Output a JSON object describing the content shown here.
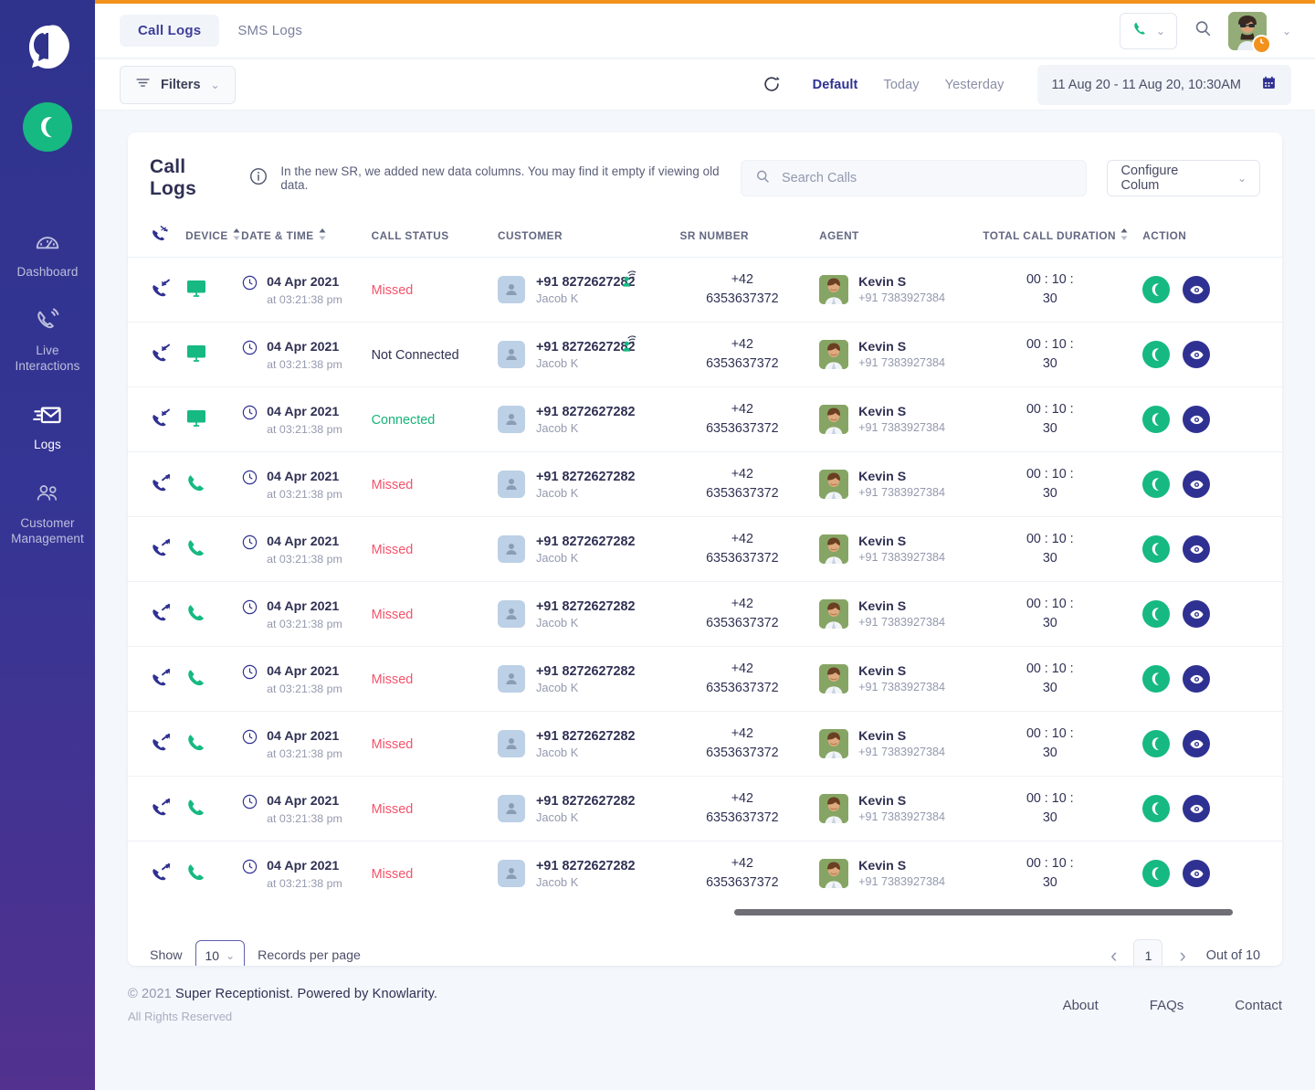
{
  "brand": {
    "accent_orange": "#f2921d",
    "green": "#16b981",
    "navy": "#2f3192",
    "red": "#f4526b"
  },
  "sidebar": {
    "logo_name": "headset-logo",
    "call_button_label": "",
    "items": [
      {
        "label": "Dashboard",
        "icon": "gauge-icon",
        "active": false
      },
      {
        "label": "Live\nInteractions",
        "icon": "live-call-icon",
        "active": false
      },
      {
        "label": "Logs",
        "icon": "envelope-icon",
        "active": true
      },
      {
        "label": "Customer\nManagement",
        "icon": "people-icon",
        "active": false
      }
    ]
  },
  "header": {
    "tabs": [
      {
        "label": "Call Logs",
        "active": true
      },
      {
        "label": "SMS Logs",
        "active": false
      }
    ],
    "call_icon": "phone-icon",
    "search_icon": "search-icon",
    "avatar_icon": "user-avatar",
    "status_badge_icon": "clock-icon"
  },
  "filterbar": {
    "filters_label": "Filters",
    "filters_icon": "filter-icon",
    "refresh_icon": "refresh-icon",
    "ranges": [
      {
        "label": "Default",
        "active": true
      },
      {
        "label": "Today",
        "active": false
      },
      {
        "label": "Yesterday",
        "active": false
      }
    ],
    "date_range": "11 Aug 20 - 11 Aug 20, 10:30AM",
    "calendar_icon": "calendar-icon"
  },
  "card": {
    "title": "Call Logs",
    "info_icon": "info-icon",
    "note": "In the new SR, we added new data columns. You may find it empty if viewing old data.",
    "search_placeholder": "Search Calls",
    "search_value": "",
    "configure_label": "Configure Colum"
  },
  "table": {
    "columns": [
      {
        "key": "direction",
        "label": "",
        "icon": "call-direction-icon",
        "sortable": false
      },
      {
        "key": "device",
        "label": "DEVICE",
        "sortable": true
      },
      {
        "key": "datetime",
        "label": "DATE & TIME",
        "sortable": true
      },
      {
        "key": "status",
        "label": "CALL STATUS",
        "sortable": false
      },
      {
        "key": "customer",
        "label": "CUSTOMER",
        "sortable": false
      },
      {
        "key": "sr_number",
        "label": "SR NUMBER",
        "sortable": false
      },
      {
        "key": "agent",
        "label": "AGENT",
        "sortable": false
      },
      {
        "key": "duration",
        "label": "TOTAL CALL DURATION",
        "sortable": true
      },
      {
        "key": "action",
        "label": "ACTION",
        "sortable": false
      }
    ],
    "rows": [
      {
        "direction": "incoming",
        "device": "desktop",
        "date": "04 Apr 2021",
        "time": "at 03:21:38 pm",
        "status": "Missed",
        "status_kind": "missed",
        "cust_number": "+91 8272627282",
        "cust_name": "Jacob K",
        "cust_wifi": true,
        "sr_line1": "+42",
        "sr_line2": "6353637372",
        "agent_name": "Kevin S",
        "agent_number": "+91 7383927384",
        "dur_line1": "00 : 10 :",
        "dur_line2": "30"
      },
      {
        "direction": "incoming",
        "device": "desktop",
        "date": "04 Apr 2021",
        "time": "at 03:21:38 pm",
        "status": "Not Connected",
        "status_kind": "notconnected",
        "cust_number": "+91 8272627282",
        "cust_name": "Jacob K",
        "cust_wifi": true,
        "sr_line1": "+42",
        "sr_line2": "6353637372",
        "agent_name": "Kevin S",
        "agent_number": "+91 7383927384",
        "dur_line1": "00 : 10 :",
        "dur_line2": "30"
      },
      {
        "direction": "incoming",
        "device": "desktop",
        "date": "04 Apr 2021",
        "time": "at 03:21:38 pm",
        "status": "Connected",
        "status_kind": "connected",
        "cust_number": "+91 8272627282",
        "cust_name": "Jacob K",
        "cust_wifi": false,
        "sr_line1": "+42",
        "sr_line2": "6353637372",
        "agent_name": "Kevin S",
        "agent_number": "+91 7383927384",
        "dur_line1": "00 : 10 :",
        "dur_line2": "30"
      },
      {
        "direction": "outgoing",
        "device": "mobile",
        "date": "04 Apr 2021",
        "time": "at 03:21:38 pm",
        "status": "Missed",
        "status_kind": "missed",
        "cust_number": "+91 8272627282",
        "cust_name": "Jacob K",
        "cust_wifi": false,
        "sr_line1": "+42",
        "sr_line2": "6353637372",
        "agent_name": "Kevin S",
        "agent_number": "+91 7383927384",
        "dur_line1": "00 : 10 :",
        "dur_line2": "30"
      },
      {
        "direction": "outgoing",
        "device": "mobile",
        "date": "04 Apr 2021",
        "time": "at 03:21:38 pm",
        "status": "Missed",
        "status_kind": "missed",
        "cust_number": "+91 8272627282",
        "cust_name": "Jacob K",
        "cust_wifi": false,
        "sr_line1": "+42",
        "sr_line2": "6353637372",
        "agent_name": "Kevin S",
        "agent_number": "+91 7383927384",
        "dur_line1": "00 : 10 :",
        "dur_line2": "30"
      },
      {
        "direction": "outgoing",
        "device": "mobile",
        "date": "04 Apr 2021",
        "time": "at 03:21:38 pm",
        "status": "Missed",
        "status_kind": "missed",
        "cust_number": "+91 8272627282",
        "cust_name": "Jacob K",
        "cust_wifi": false,
        "sr_line1": "+42",
        "sr_line2": "6353637372",
        "agent_name": "Kevin S",
        "agent_number": "+91 7383927384",
        "dur_line1": "00 : 10 :",
        "dur_line2": "30"
      },
      {
        "direction": "outgoing",
        "device": "mobile",
        "date": "04 Apr 2021",
        "time": "at 03:21:38 pm",
        "status": "Missed",
        "status_kind": "missed",
        "cust_number": "+91 8272627282",
        "cust_name": "Jacob K",
        "cust_wifi": false,
        "sr_line1": "+42",
        "sr_line2": "6353637372",
        "agent_name": "Kevin S",
        "agent_number": "+91 7383927384",
        "dur_line1": "00 : 10 :",
        "dur_line2": "30"
      },
      {
        "direction": "outgoing",
        "device": "mobile",
        "date": "04 Apr 2021",
        "time": "at 03:21:38 pm",
        "status": "Missed",
        "status_kind": "missed",
        "cust_number": "+91 8272627282",
        "cust_name": "Jacob K",
        "cust_wifi": false,
        "sr_line1": "+42",
        "sr_line2": "6353637372",
        "agent_name": "Kevin S",
        "agent_number": "+91 7383927384",
        "dur_line1": "00 : 10 :",
        "dur_line2": "30"
      },
      {
        "direction": "outgoing",
        "device": "mobile",
        "date": "04 Apr 2021",
        "time": "at 03:21:38 pm",
        "status": "Missed",
        "status_kind": "missed",
        "cust_number": "+91 8272627282",
        "cust_name": "Jacob K",
        "cust_wifi": false,
        "sr_line1": "+42",
        "sr_line2": "6353637372",
        "agent_name": "Kevin S",
        "agent_number": "+91 7383927384",
        "dur_line1": "00 : 10 :",
        "dur_line2": "30"
      },
      {
        "direction": "outgoing",
        "device": "mobile",
        "date": "04 Apr 2021",
        "time": "at 03:21:38 pm",
        "status": "Missed",
        "status_kind": "missed",
        "cust_number": "+91 8272627282",
        "cust_name": "Jacob K",
        "cust_wifi": false,
        "sr_line1": "+42",
        "sr_line2": "6353637372",
        "agent_name": "Kevin S",
        "agent_number": "+91 7383927384",
        "dur_line1": "00 : 10 :",
        "dur_line2": "30"
      }
    ],
    "action_icons": {
      "call": "phone-icon",
      "view": "eye-icon"
    }
  },
  "pagination": {
    "show_label": "Show",
    "page_size": "10",
    "records_label": "Records per page",
    "prev_icon": "chevron-left-icon",
    "next_icon": "chevron-right-icon",
    "current_page": "1",
    "out_of": "Out of 10"
  },
  "footer": {
    "copyright_year": "© 2021",
    "copyright_text": "Super Receptionist. Powered by Knowlarity.",
    "rights": "All Rights Reserved",
    "links": [
      {
        "label": "About"
      },
      {
        "label": "FAQs"
      },
      {
        "label": "Contact"
      }
    ]
  }
}
